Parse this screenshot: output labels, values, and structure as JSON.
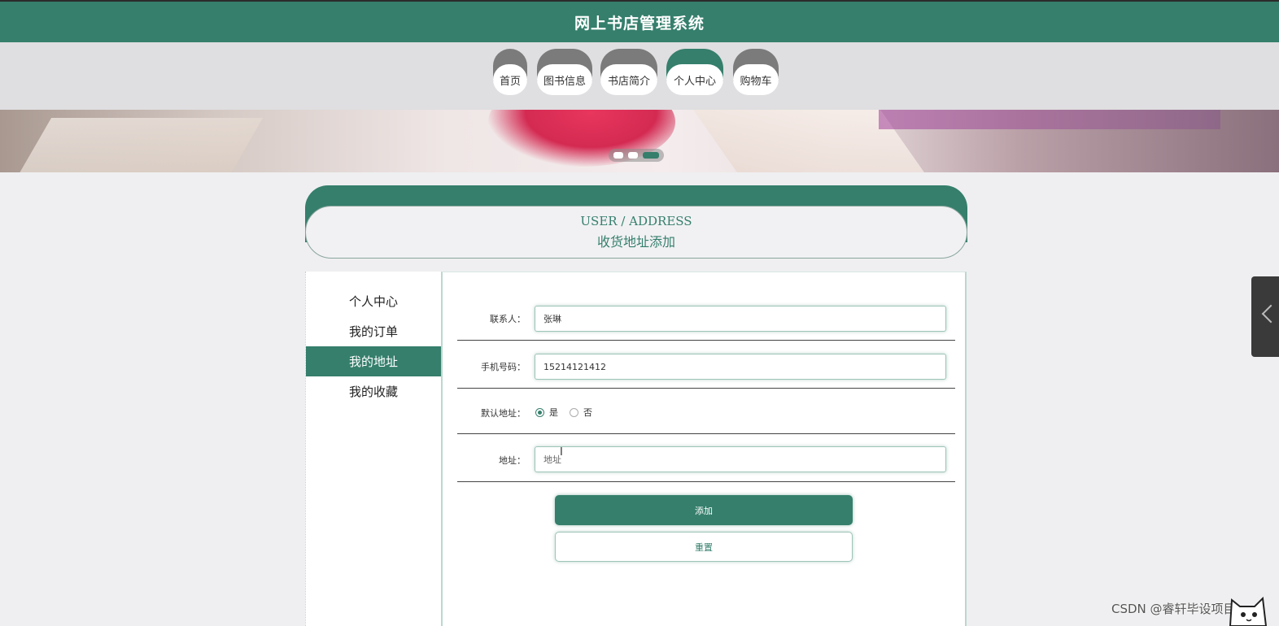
{
  "app": {
    "title": "网上书店管理系统"
  },
  "nav": {
    "items": [
      {
        "label": "首页",
        "active": false
      },
      {
        "label": "图书信息",
        "active": false
      },
      {
        "label": "书店简介",
        "active": false
      },
      {
        "label": "个人中心",
        "active": true
      },
      {
        "label": "购物车",
        "active": false
      }
    ]
  },
  "banner": {
    "slide_count": 3,
    "active_slide": 3
  },
  "page_header": {
    "en": "USER / ADDRESS",
    "cn": "收货地址添加"
  },
  "sidebar": {
    "items": [
      {
        "label": "个人中心",
        "active": false
      },
      {
        "label": "我的订单",
        "active": false
      },
      {
        "label": "我的地址",
        "active": true
      },
      {
        "label": "我的收藏",
        "active": false
      }
    ]
  },
  "form": {
    "contact": {
      "label": "联系人：",
      "value": "张琳"
    },
    "phone": {
      "label": "手机号码：",
      "value": "15214121412"
    },
    "default_address": {
      "label": "默认地址：",
      "options": [
        "是",
        "否"
      ],
      "selected": "是"
    },
    "address": {
      "label": "地址：",
      "value": "",
      "placeholder": "地址"
    },
    "submit_label": "添加",
    "reset_label": "重置"
  },
  "watermark": "CSDN @睿轩毕设项目",
  "colors": {
    "primary": "#357f6c",
    "nav_inactive": "#7b7b7b",
    "background": "#efeff1"
  },
  "icons": {
    "side_tab": "chevron-left-icon",
    "cursor": "text-cursor-icon",
    "mascot": "cat-mascot-icon"
  }
}
